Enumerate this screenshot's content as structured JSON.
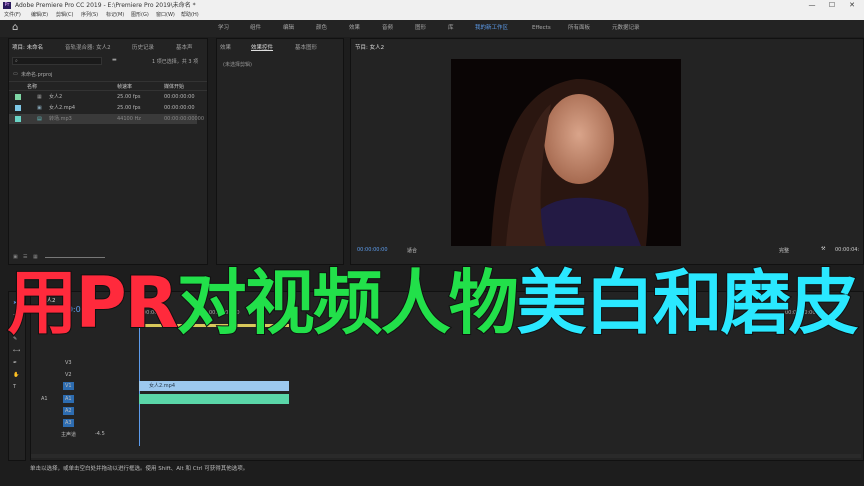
{
  "titlebar": {
    "title": "Adobe Premiere Pro CC 2019 - E:\\Premiere Pro 2019\\未命名 *",
    "minimize": "—",
    "maximize": "☐",
    "close": "✕"
  },
  "menubar": {
    "items": [
      "文件(F)",
      "编辑(E)",
      "剪辑(C)",
      "序列(S)",
      "标记(M)",
      "图形(G)",
      "窗口(W)",
      "帮助(H)"
    ]
  },
  "workspaces": {
    "items": [
      "学习",
      "组件",
      "编辑",
      "颜色",
      "效果",
      "音频",
      "图形",
      "库",
      "我的新工作区",
      "Effects",
      "所有面板",
      "元数据记录"
    ],
    "active_index": 8
  },
  "project": {
    "tabs": [
      "项目: 未命名",
      "音轨混合器: 女人2",
      "历史记录",
      "基本声"
    ],
    "selection_info": "1 项已选择，共 3 项",
    "file": "未命名.prproj",
    "columns": [
      "名称",
      "帧速率",
      "媒体开始"
    ],
    "rows": [
      {
        "name": "女人2",
        "fps": "25.00 fps",
        "start": "00:00:00:00",
        "color": "#7ed6a4"
      },
      {
        "name": "女人2.mp4",
        "fps": "25.00 fps",
        "start": "00:00:00:00",
        "color": "#7ec8e6"
      },
      {
        "name": "转场.mp3",
        "fps": "44100 Hz",
        "start": "00:00:00:00000",
        "color": "#6ad4c6"
      }
    ]
  },
  "effects": {
    "tabs": [
      "效果",
      "效果控件",
      "基本图形"
    ],
    "no_clip": "(未选择剪辑)"
  },
  "program": {
    "tab": "节目: 女人2",
    "timecode": "00:00:00:00",
    "fit": "适合",
    "quality": "完整",
    "duration": "00:00:04:"
  },
  "timeline": {
    "sequence_tab": "女人2",
    "timecode": "00:00:00:00",
    "ruler": [
      "00:00",
      "00:00:05:00",
      "00:00:40:00"
    ],
    "video_tracks": [
      "V3",
      "V2",
      "V1"
    ],
    "audio_tracks": [
      "A1",
      "A2",
      "A3"
    ],
    "source_v": "V1",
    "source_a": "A1",
    "master": "主声道",
    "master_value": "-4.5",
    "clip_video": "女人2.mp4",
    "clip_audio": ""
  },
  "overlay": {
    "parts": [
      "用PR",
      "对视频人物",
      "美白和磨皮"
    ],
    "colors": [
      "#ff2a3c",
      "#22e04a",
      "#2ae8ff"
    ]
  },
  "status": {
    "text": "单击以选择，或单击空白处并拖动以进行框选。使用 Shift、Alt 和 Ctrl 可获得其他选项。"
  }
}
